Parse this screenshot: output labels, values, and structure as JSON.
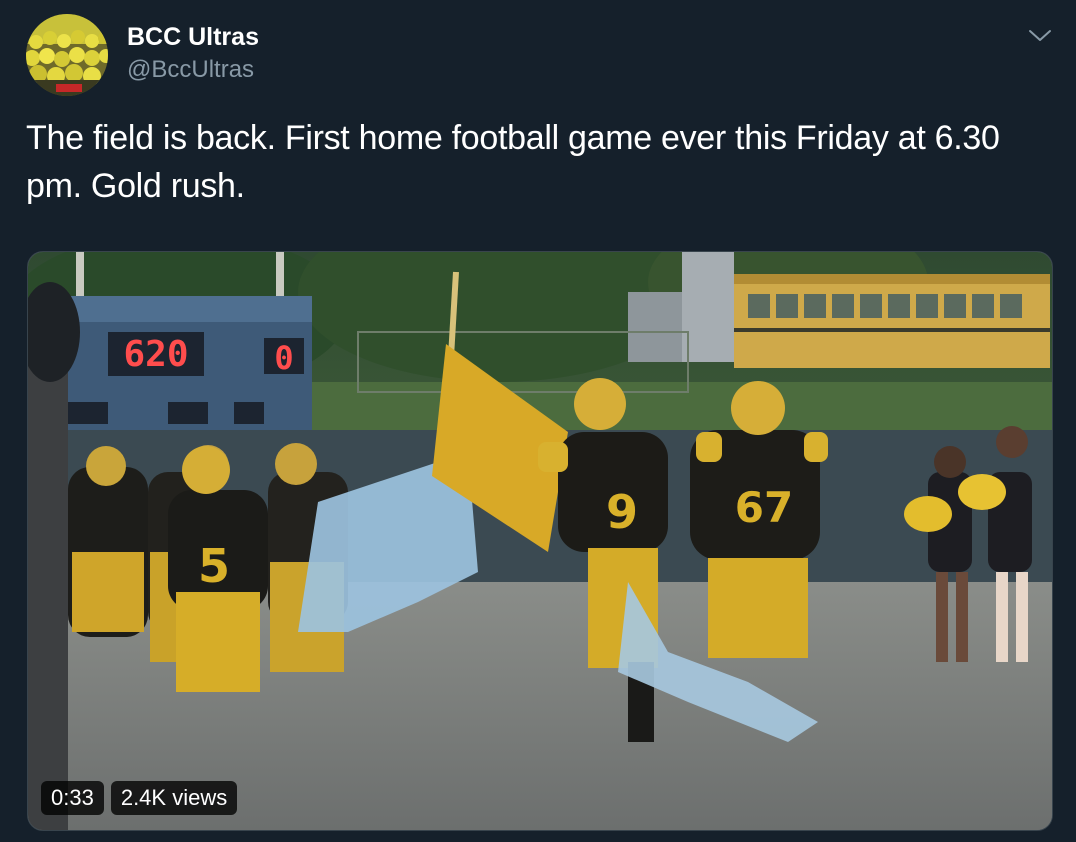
{
  "author": {
    "display_name": "BCC Ultras",
    "handle": "@BccUltras",
    "avatar_icon": "crowd-avatar-icon"
  },
  "menu": {
    "icon": "chevron-down-icon"
  },
  "tweet": {
    "text": "The field is back. First home football game ever this Friday at 6.30 pm. Gold rush."
  },
  "media": {
    "type": "video",
    "duration": "0:33",
    "views": "2.4K views",
    "scoreboard": {
      "home_score": "620",
      "guest_score": "0"
    },
    "jerseys": [
      "5",
      "9",
      "67"
    ]
  },
  "colors": {
    "background": "#15202b",
    "secondary_text": "#8899a6",
    "border": "#38444d",
    "team_gold": "#d9b12a"
  }
}
